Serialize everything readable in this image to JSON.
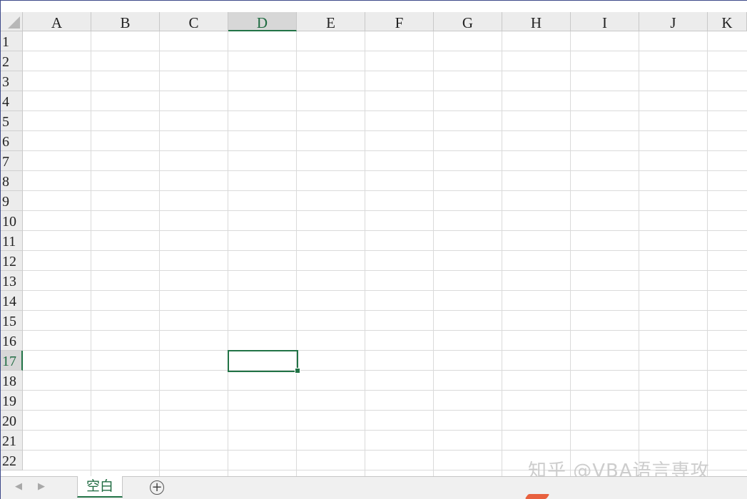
{
  "sheet": {
    "columns": [
      "A",
      "B",
      "C",
      "D",
      "E",
      "F",
      "G",
      "H",
      "I",
      "J",
      "K"
    ],
    "rows": [
      "1",
      "2",
      "3",
      "4",
      "5",
      "6",
      "7",
      "8",
      "9",
      "10",
      "11",
      "12",
      "13",
      "14",
      "15",
      "16",
      "17",
      "18",
      "19",
      "20",
      "21",
      "22"
    ],
    "selected_column": "D",
    "selected_row": "17"
  },
  "tabs": {
    "prev_icon": "◀",
    "next_icon": "▶",
    "sheet_name": "空白",
    "add_icon": "+"
  },
  "watermark": "知乎 @VBA语言専攻",
  "colors": {
    "accent": "#217346",
    "header_bg": "#ececec",
    "gridline": "#dadada"
  }
}
